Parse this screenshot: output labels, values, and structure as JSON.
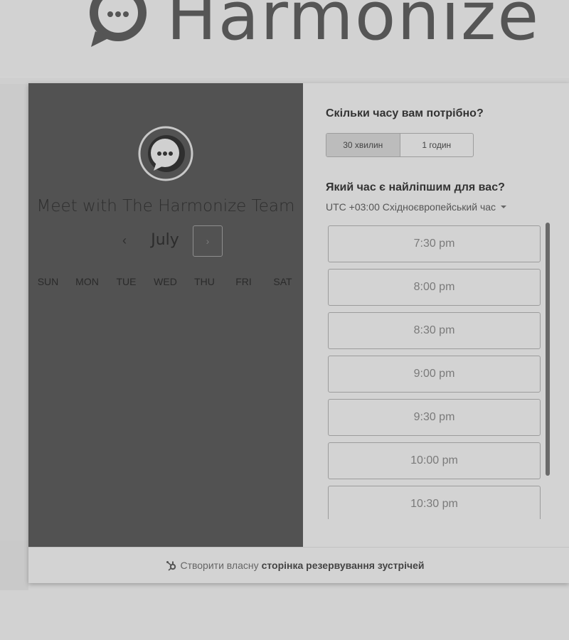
{
  "brand": {
    "name": "Harmonize",
    "logo_icon": "chat-bubble-icon"
  },
  "scheduler": {
    "title": "Meet with The Harmonize Team",
    "avatar_icon": "chat-bubble-icon",
    "month": "July",
    "prev_icon": "‹",
    "next_icon": "›",
    "weekdays": [
      "SUN",
      "MON",
      "TUE",
      "WED",
      "THU",
      "FRI",
      "SAT"
    ]
  },
  "duration": {
    "question": "Скільки часу вам потрібно?",
    "options": [
      "30 хвилин",
      "1 годин"
    ],
    "selected": "30 хвилин"
  },
  "time": {
    "question": "Який час є найліпшим для вас?",
    "timezone": "UTC +03:00 Східноєвропейський час",
    "slots": [
      "7:30 pm",
      "8:00 pm",
      "8:30 pm",
      "9:00 pm",
      "9:30 pm",
      "10:00 pm",
      "10:30 pm"
    ]
  },
  "footer": {
    "prefix": "Створити власну",
    "link": "сторінка резервування зустрічей",
    "icon": "hubspot-sprocket-icon"
  },
  "colors": {
    "left_panel": "#525252",
    "background": "#d3d3d3",
    "brand_text": "#555555"
  }
}
